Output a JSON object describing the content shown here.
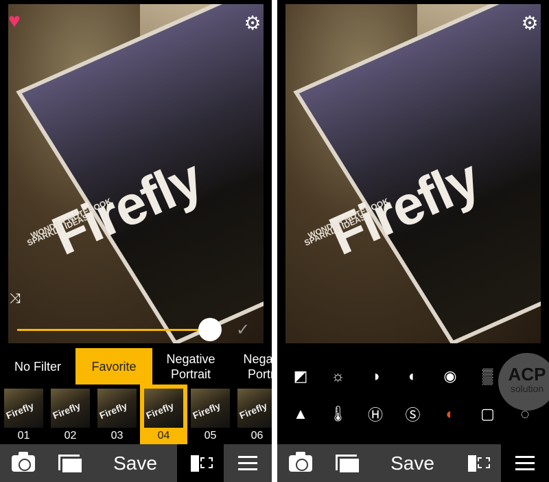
{
  "photo": {
    "title": "Firefly",
    "line1": "WONDER NOTEBOOK",
    "line2": "SPARKLE IDEAS"
  },
  "left": {
    "favorite_icon": "heart-icon",
    "settings_icon": "gear-icon",
    "shuffle_icon": "shuffle-icon",
    "slider": {
      "value": 0.8
    },
    "tabs": [
      {
        "label": "No Filter"
      },
      {
        "label": "Favorite",
        "active": true
      },
      {
        "label": "Negative Portrait"
      },
      {
        "label": "Negative Portrait"
      }
    ],
    "thumbs": [
      {
        "label": "01"
      },
      {
        "label": "02"
      },
      {
        "label": "03"
      },
      {
        "label": "04",
        "active": true
      },
      {
        "label": "05"
      },
      {
        "label": "06"
      }
    ],
    "toolbar": {
      "save": "Save",
      "active": "filters"
    }
  },
  "right": {
    "settings_icon": "gear-icon",
    "adjustments_row1": [
      "exposure-icon",
      "brightness-icon",
      "contrast-icon",
      "gradient-icon",
      "vignette-icon",
      "grain-icon"
    ],
    "adjustments_row2": [
      "sharpen-icon",
      "temperature-icon",
      "highlights-icon",
      "shadows-icon",
      "light-leak-icon",
      "frame-icon",
      "texture-icon"
    ],
    "watermark": {
      "line1": "ACP",
      "line2": "solution"
    },
    "toolbar": {
      "save": "Save",
      "active": "adjust"
    }
  },
  "colors": {
    "accent": "#fbb800",
    "toolbar": "#3c3c3c",
    "heart": "#f0356a"
  }
}
